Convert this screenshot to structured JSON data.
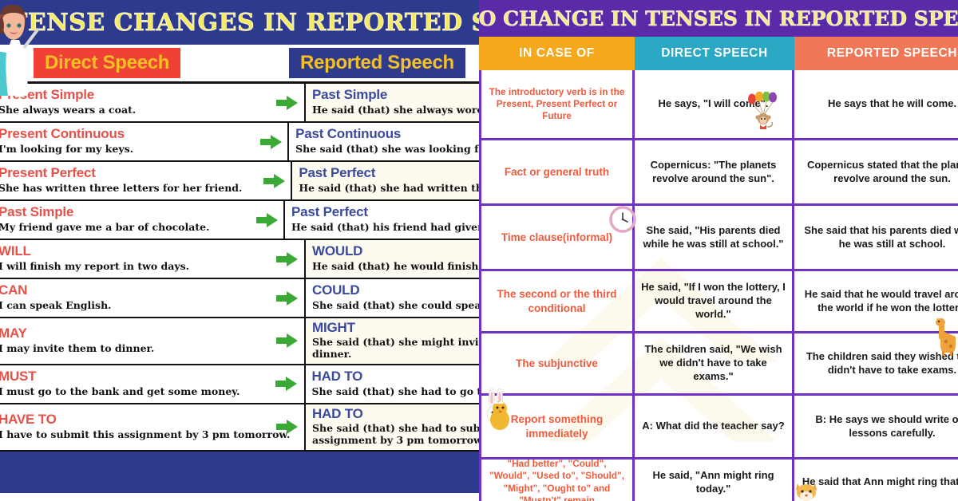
{
  "left_panel": {
    "title": "TENSE CHANGES IN REPORTED SPEECH",
    "direct_chip": "Direct Speech",
    "reported_chip": "Reported Speech",
    "colors": {
      "header_bg": "#2e3a8c",
      "header_text": "#f6ea62",
      "direct_chip_bg": "#ef4136",
      "chip_text": "#f6c023",
      "direct_tense": "#e8514a",
      "reported_tense": "#3a4a9e",
      "arrow": "#3aa935"
    },
    "rows": [
      {
        "direct_tense": "Present Simple",
        "direct_example": "She always wears a coat.",
        "reported_tense": "Past Simple",
        "reported_example": "He said (that) she always wore a coat."
      },
      {
        "direct_tense": "Present Continuous",
        "direct_example": "I'm looking for my keys.",
        "reported_tense": "Past Continuous",
        "reported_example": "She said (that) she was looking for her keys."
      },
      {
        "direct_tense": "Present Perfect",
        "direct_example": "She has written three letters for her friend.",
        "reported_tense": "Past Perfect",
        "reported_example": "He said (that) she had written three letters."
      },
      {
        "direct_tense": "Past Simple",
        "direct_example": "My friend gave me a bar of chocolate.",
        "reported_tense": "Past Perfect",
        "reported_example": "He said (that) his friend had given him a bar."
      },
      {
        "direct_tense": "WILL",
        "direct_example": "I will finish my report in two days.",
        "reported_tense": "WOULD",
        "reported_example": "He said (that) he would finish his report."
      },
      {
        "direct_tense": "CAN",
        "direct_example": "I can speak English.",
        "reported_tense": "COULD",
        "reported_example": "She said (that) she could speak English."
      },
      {
        "direct_tense": "MAY",
        "direct_example": "I may invite them to dinner.",
        "reported_tense": "MIGHT",
        "reported_example": "She said (that) she might invite them to dinner."
      },
      {
        "direct_tense": "MUST",
        "direct_example": "I must go to the bank and get some money.",
        "reported_tense": "HAD TO",
        "reported_example": "She said (that) she had to go to the bank."
      },
      {
        "direct_tense": "HAVE TO",
        "direct_example": "I have to submit this assignment by 3 pm tomorrow.",
        "reported_tense": "HAD TO",
        "reported_example": "She said (that) she had to submit this assignment by 3 pm tomorrow."
      }
    ]
  },
  "right_panel": {
    "title": "NO CHANGE IN TENSES IN REPORTED SPEECH",
    "colors": {
      "header_bg": "#5a2aa8",
      "header_text": "#f7e98e",
      "col1_bg": "#f5a81c",
      "col2_bg": "#2ba9c4",
      "col3_bg": "#f07856",
      "grid": "#6f31c4",
      "case_text": "#ef5b3c"
    },
    "columns": [
      "IN CASE OF",
      "DIRECT SPEECH",
      "REPORTED SPEECH"
    ],
    "rows": [
      {
        "case": "The introductory verb is in the Present, Present Perfect or Future",
        "direct": "He says, \"I will come\".",
        "reported": "He says that he will come."
      },
      {
        "case": "Fact or general truth",
        "direct": "Copernicus: \"The planets revolve around the sun\".",
        "reported": "Copernicus stated that the planets revolve around the sun."
      },
      {
        "case": "Time clause(informal)",
        "direct": "She said, \"His parents died while he was still at school.\"",
        "reported": "She said that his parents died while he was still at school."
      },
      {
        "case": "The second or the third conditional",
        "direct": "He said, \"If I won the lottery, I would travel around the world.\"",
        "reported": "He said that he would travel around the world if he won the lottery."
      },
      {
        "case": "The subjunctive",
        "direct": "The children said, \"We wish we didn't have to take exams.\"",
        "reported": "The children said they wished they didn't have to take exams."
      },
      {
        "case": "Report something immediately",
        "direct": "A: What did the teacher say?",
        "reported": "B: He says we should write our lessons carefully."
      },
      {
        "case": "\"Had better\", \"Could\", \"Would\", \"Used to\", \"Should\", \"Might\", \"Ought to\" and \"Mustn't\" remain",
        "direct": "He said, \"Ann might ring today.\"",
        "reported": "He said that Ann might ring that day."
      }
    ]
  },
  "decorations": {
    "teacher_girl": "girl-teacher-icon",
    "monkey_balloons": "monkey-balloons-icon",
    "clock": "clock-icon",
    "giraffe": "giraffe-icon",
    "bunny": "bunny-icon",
    "chick": "chick-icon",
    "fox": "fox-icon"
  }
}
